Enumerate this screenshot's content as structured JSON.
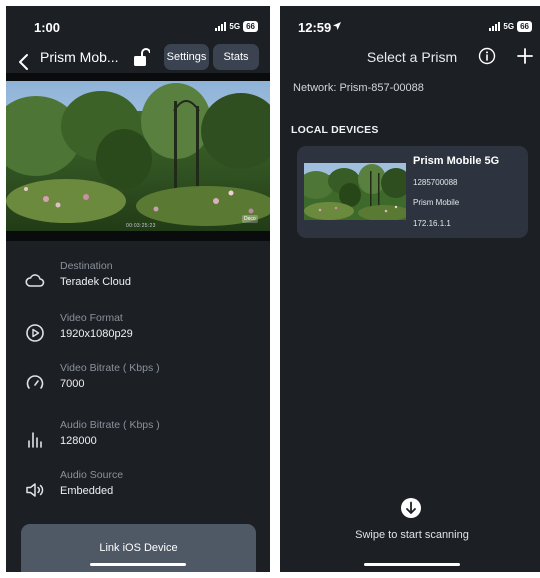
{
  "left_screen": {
    "status": {
      "time": "1:00",
      "network": "5G",
      "battery": "66"
    },
    "header": {
      "title": "Prism Mob...",
      "settings_label": "Settings",
      "stats_label": "Stats"
    },
    "video": {
      "timecode": "00:03:25:23",
      "badge": "Deco"
    },
    "info": [
      {
        "label": "Destination",
        "value": "Teradek Cloud",
        "icon": "cloud-icon"
      },
      {
        "label": "Video Format",
        "value": "1920x1080p29",
        "icon": "play-circle-icon"
      },
      {
        "label": "Video Bitrate ( Kbps )",
        "value": "7000",
        "icon": "gauge-icon"
      },
      {
        "label": "Audio Bitrate ( Kbps )",
        "value": "128000",
        "icon": "audio-bars-icon"
      },
      {
        "label": "Audio Source",
        "value": "Embedded",
        "icon": "speaker-icon"
      }
    ],
    "link_button": "Link iOS Device"
  },
  "right_screen": {
    "status": {
      "time": "12:59",
      "network": "5G",
      "battery": "66"
    },
    "header": {
      "title": "Select a Prism"
    },
    "network_label": "Network:",
    "network_value": "Prism-857-00088",
    "section_title": "LOCAL DEVICES",
    "device": {
      "name": "Prism Mobile 5G",
      "serial": "1285700088",
      "model": "Prism Mobile",
      "ip": "172.16.1.1"
    },
    "scan_text": "Swipe to start scanning"
  },
  "colors": {
    "background": "#1c1f24",
    "button": "#3b4350",
    "card": "#2d3440",
    "link_button": "#4f5966"
  }
}
